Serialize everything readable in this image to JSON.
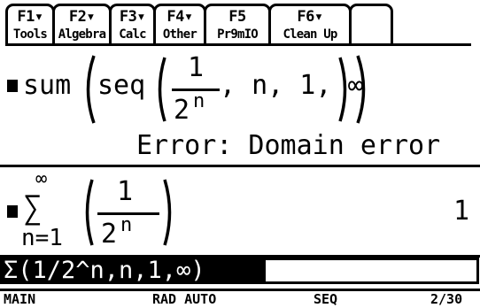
{
  "toolbar": {
    "tabs": [
      {
        "key": "F1▾",
        "label": "Tools"
      },
      {
        "key": "F2▾",
        "label": "Algebra"
      },
      {
        "key": "F3▾",
        "label": "Calc"
      },
      {
        "key": "F4▾",
        "label": "Other"
      },
      {
        "key": "F5",
        "label": "Pr9mIO"
      },
      {
        "key": "F6▾",
        "label": "Clean Up"
      }
    ]
  },
  "history": {
    "entry1": {
      "func": "sum",
      "seq": "seq",
      "numerator": "1",
      "denominator": "2",
      "exponent": "n",
      "args": ", n, 1, ∞"
    },
    "error_message": "Error: Domain error",
    "entry2": {
      "sigma": "∑",
      "upper": "∞",
      "lower": "n=1",
      "numerator": "1",
      "denominator": "2",
      "exponent": "n",
      "result": "1"
    }
  },
  "entry_line": {
    "text": "Σ(1/2^n,n,1,∞)"
  },
  "status_bar": {
    "folder": "MAIN",
    "mode": "RAD AUTO",
    "graph": "SEQ",
    "history": "2/30"
  }
}
